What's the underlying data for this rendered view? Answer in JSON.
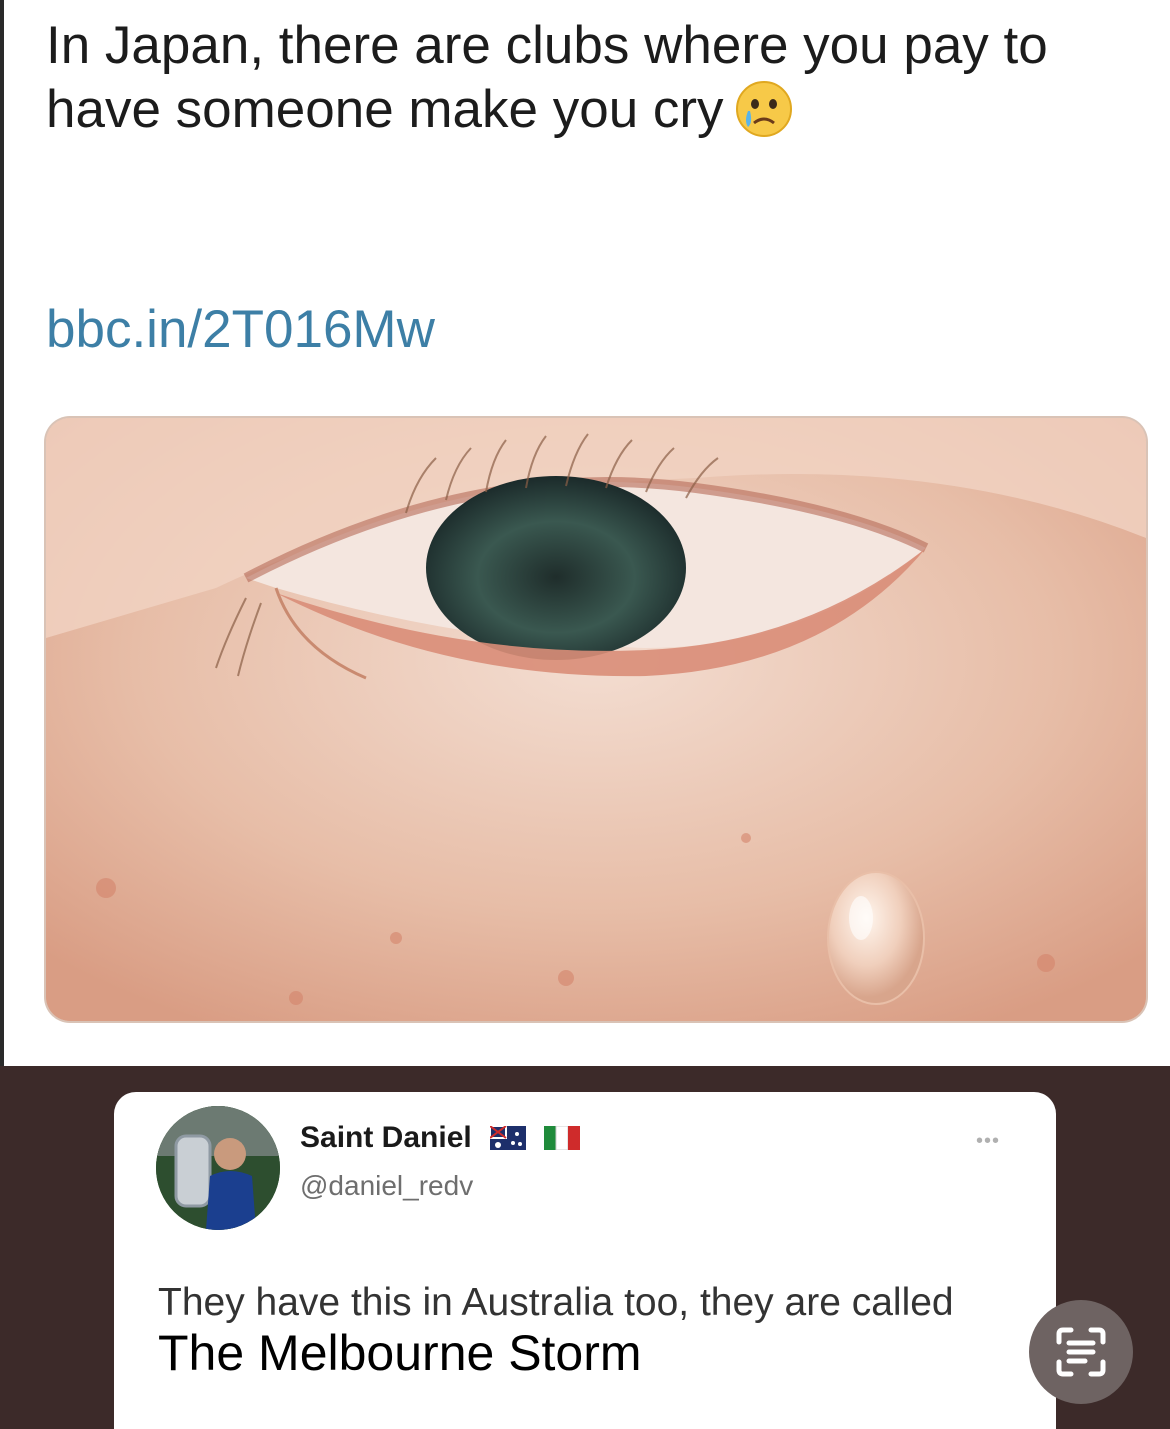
{
  "post": {
    "headline": "In Japan, there are clubs where you pay to have someone make you cry",
    "emoji": "crying-face",
    "link": "bbc.in/2T016Mw",
    "image": "crying-eye-closeup"
  },
  "reply": {
    "author_name": "Saint Daniel",
    "flags": [
      "australia-flag",
      "italy-flag"
    ],
    "handle": "@daniel_redv",
    "text_start": "They have this in Australia too, they are called ",
    "text_overlay": "The Melbourne Storm"
  },
  "icons": {
    "more": "more-options-icon",
    "scan": "live-text-scan-icon"
  },
  "colors": {
    "link": "#3d7fa6",
    "bottom_background": "#3c2a29",
    "card": "#ffffff"
  }
}
